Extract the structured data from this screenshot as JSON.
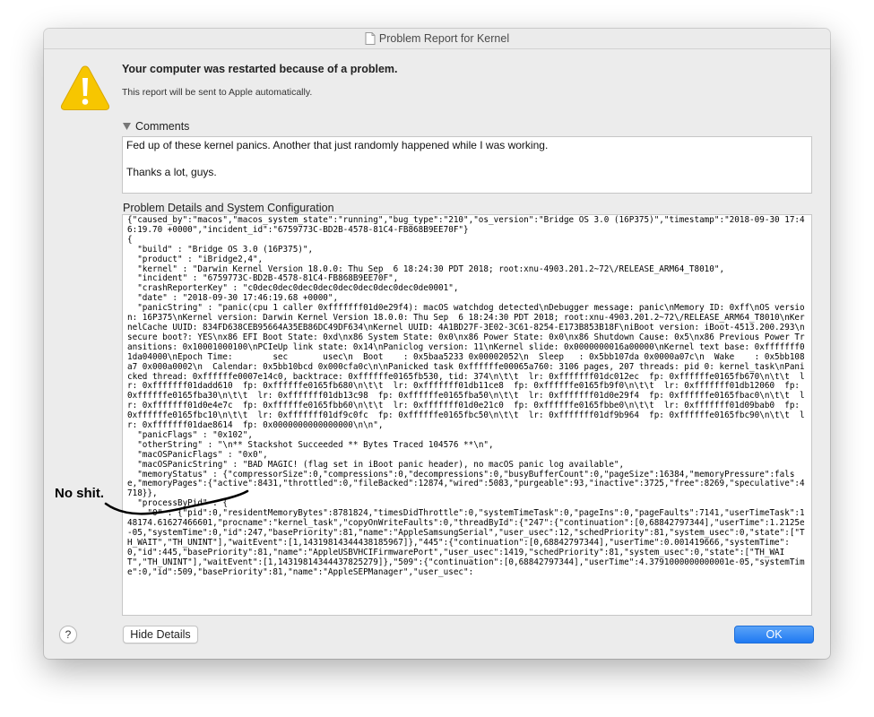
{
  "window": {
    "title": "Problem Report for Kernel"
  },
  "alert": {
    "headline": "Your computer was restarted because of a problem.",
    "subline": "This report will be sent to Apple automatically."
  },
  "comments": {
    "label": "Comments",
    "line1": "Fed up of these kernel panics. Another that just randomly happened while I was working.",
    "line2": "Thanks a lot, guys."
  },
  "details": {
    "label": "Problem Details and System Configuration",
    "text": "{\"caused_by\":\"macos\",\"macos_system_state\":\"running\",\"bug_type\":\"210\",\"os_version\":\"Bridge OS 3.0 (16P375)\",\"timestamp\":\"2018-09-30 17:46:19.70 +0000\",\"incident_id\":\"6759773C-BD2B-4578-81C4-FB868B9EE70F\"}\n{\n  \"build\" : \"Bridge OS 3.0 (16P375)\",\n  \"product\" : \"iBridge2,4\",\n  \"kernel\" : \"Darwin Kernel Version 18.0.0: Thu Sep  6 18:24:30 PDT 2018; root:xnu-4903.201.2~72\\/RELEASE_ARM64_T8010\",\n  \"incident\" : \"6759773C-BD2B-4578-81C4-FB868B9EE70F\",\n  \"crashReporterKey\" : \"c0dec0dec0dec0dec0dec0dec0dec0dec0de0001\",\n  \"date\" : \"2018-09-30 17:46:19.68 +0000\",\n  \"panicString\" : \"panic(cpu 1 caller 0xfffffff01d0e29f4): macOS watchdog detected\\nDebugger message: panic\\nMemory ID: 0xff\\nOS version: 16P375\\nKernel version: Darwin Kernel Version 18.0.0: Thu Sep  6 18:24:30 PDT 2018; root:xnu-4903.201.2~72\\/RELEASE_ARM64_T8010\\nKernelCache UUID: 834FD638CEB95664A35EB86DC49DF634\\nKernel UUID: 4A1BD27F-3E02-3C61-8254-E173B853B18F\\niBoot version: iBoot-4513.200.293\\nsecure boot?: YES\\nx86 EFI Boot State: 0xd\\nx86 System State: 0x0\\nx86 Power State: 0x0\\nx86 Shutdown Cause: 0x5\\nx86 Previous Power Transitions: 0x10001000100\\nPCIeUp link state: 0x14\\nPaniclog version: 11\\nKernel slide: 0x0000000016a00000\\nKernel text base: 0xfffffff01da04000\\nEpoch Time:        sec       usec\\n  Boot    : 0x5baa5233 0x00002052\\n  Sleep   : 0x5bb107da 0x0000a07c\\n  Wake    : 0x5bb108a7 0x000a0002\\n  Calendar: 0x5bb10bcd 0x000cfa0c\\n\\nPanicked task 0xffffffe00065a760: 3106 pages, 207 threads: pid 0: kernel_task\\nPanicked thread: 0xffffffe0007e14c0, backtrace: 0xffffffe0165fb530, tid: 374\\n\\t\\t  lr: 0xfffffff01dc012ec  fp: 0xffffffe0165fb670\\n\\t\\t  lr: 0xfffffff01dadd610  fp: 0xffffffe0165fb680\\n\\t\\t  lr: 0xfffffff01db11ce8  fp: 0xffffffe0165fb9f0\\n\\t\\t  lr: 0xfffffff01db12060  fp: 0xffffffe0165fba30\\n\\t\\t  lr: 0xfffffff01db13c98  fp: 0xffffffe0165fba50\\n\\t\\t  lr: 0xfffffff01d0e29f4  fp: 0xffffffe0165fbac0\\n\\t\\t  lr: 0xfffffff01d0e4e7c  fp: 0xffffffe0165fbb60\\n\\t\\t  lr: 0xfffffff01d0e21c0  fp: 0xffffffe0165fbbe0\\n\\t\\t  lr: 0xfffffff01d09bab0  fp: 0xffffffe0165fbc10\\n\\t\\t  lr: 0xfffffff01df9c0fc  fp: 0xffffffe0165fbc50\\n\\t\\t  lr: 0xfffffff01df9b964  fp: 0xffffffe0165fbc90\\n\\t\\t  lr: 0xfffffff01dae8614  fp: 0x0000000000000000\\n\\n\",\n  \"panicFlags\" : \"0x102\",\n  \"otherString\" : \"\\n** Stackshot Succeeded ** Bytes Traced 104576 **\\n\",\n  \"macOSPanicFlags\" : \"0x0\",\n  \"macOSPanicString\" : \"BAD MAGIC! (flag set in iBoot panic header), no macOS panic log available\",\n  \"memoryStatus\" : {\"compressorSize\":0,\"compressions\":0,\"decompressions\":0,\"busyBufferCount\":0,\"pageSize\":16384,\"memoryPressure\":false,\"memoryPages\":{\"active\":8431,\"throttled\":0,\"fileBacked\":12874,\"wired\":5083,\"purgeable\":93,\"inactive\":3725,\"free\":8269,\"speculative\":4718}},\n  \"processByPid\" : {\n    \"0\" : {\"pid\":0,\"residentMemoryBytes\":8781824,\"timesDidThrottle\":0,\"systemTimeTask\":0,\"pageIns\":0,\"pageFaults\":7141,\"userTimeTask\":148174.61627466601,\"procname\":\"kernel_task\",\"copyOnWriteFaults\":0,\"threadById\":{\"247\":{\"continuation\":[0,68842797344],\"userTime\":1.2125e-05,\"systemTime\":0,\"id\":247,\"basePriority\":81,\"name\":\"AppleSamsungSerial\",\"user_usec\":12,\"schedPriority\":81,\"system_usec\":0,\"state\":[\"TH_WAIT\",\"TH_UNINT\"],\"waitEvent\":[1,14319814344438185967]},\"445\":{\"continuation\":[0,68842797344],\"userTime\":0.001419666,\"systemTime\":0,\"id\":445,\"basePriority\":81,\"name\":\"AppleUSBVHCIFirmwarePort\",\"user_usec\":1419,\"schedPriority\":81,\"system_usec\":0,\"state\":[\"TH_WAIT\",\"TH_UNINT\"],\"waitEvent\":[1,14319814344437825279]},\"509\":{\"continuation\":[0,68842797344],\"userTime\":4.3791000000000001e-05,\"systemTime\":0,\"id\":509,\"basePriority\":81,\"name\":\"AppleSEPManager\",\"user_usec\":"
  },
  "buttons": {
    "help": "?",
    "hide_details": "Hide Details",
    "ok": "OK"
  },
  "annotation": {
    "text": "No shit."
  },
  "colors": {
    "accent": "#1f79f2",
    "warning": "#f7c600"
  }
}
